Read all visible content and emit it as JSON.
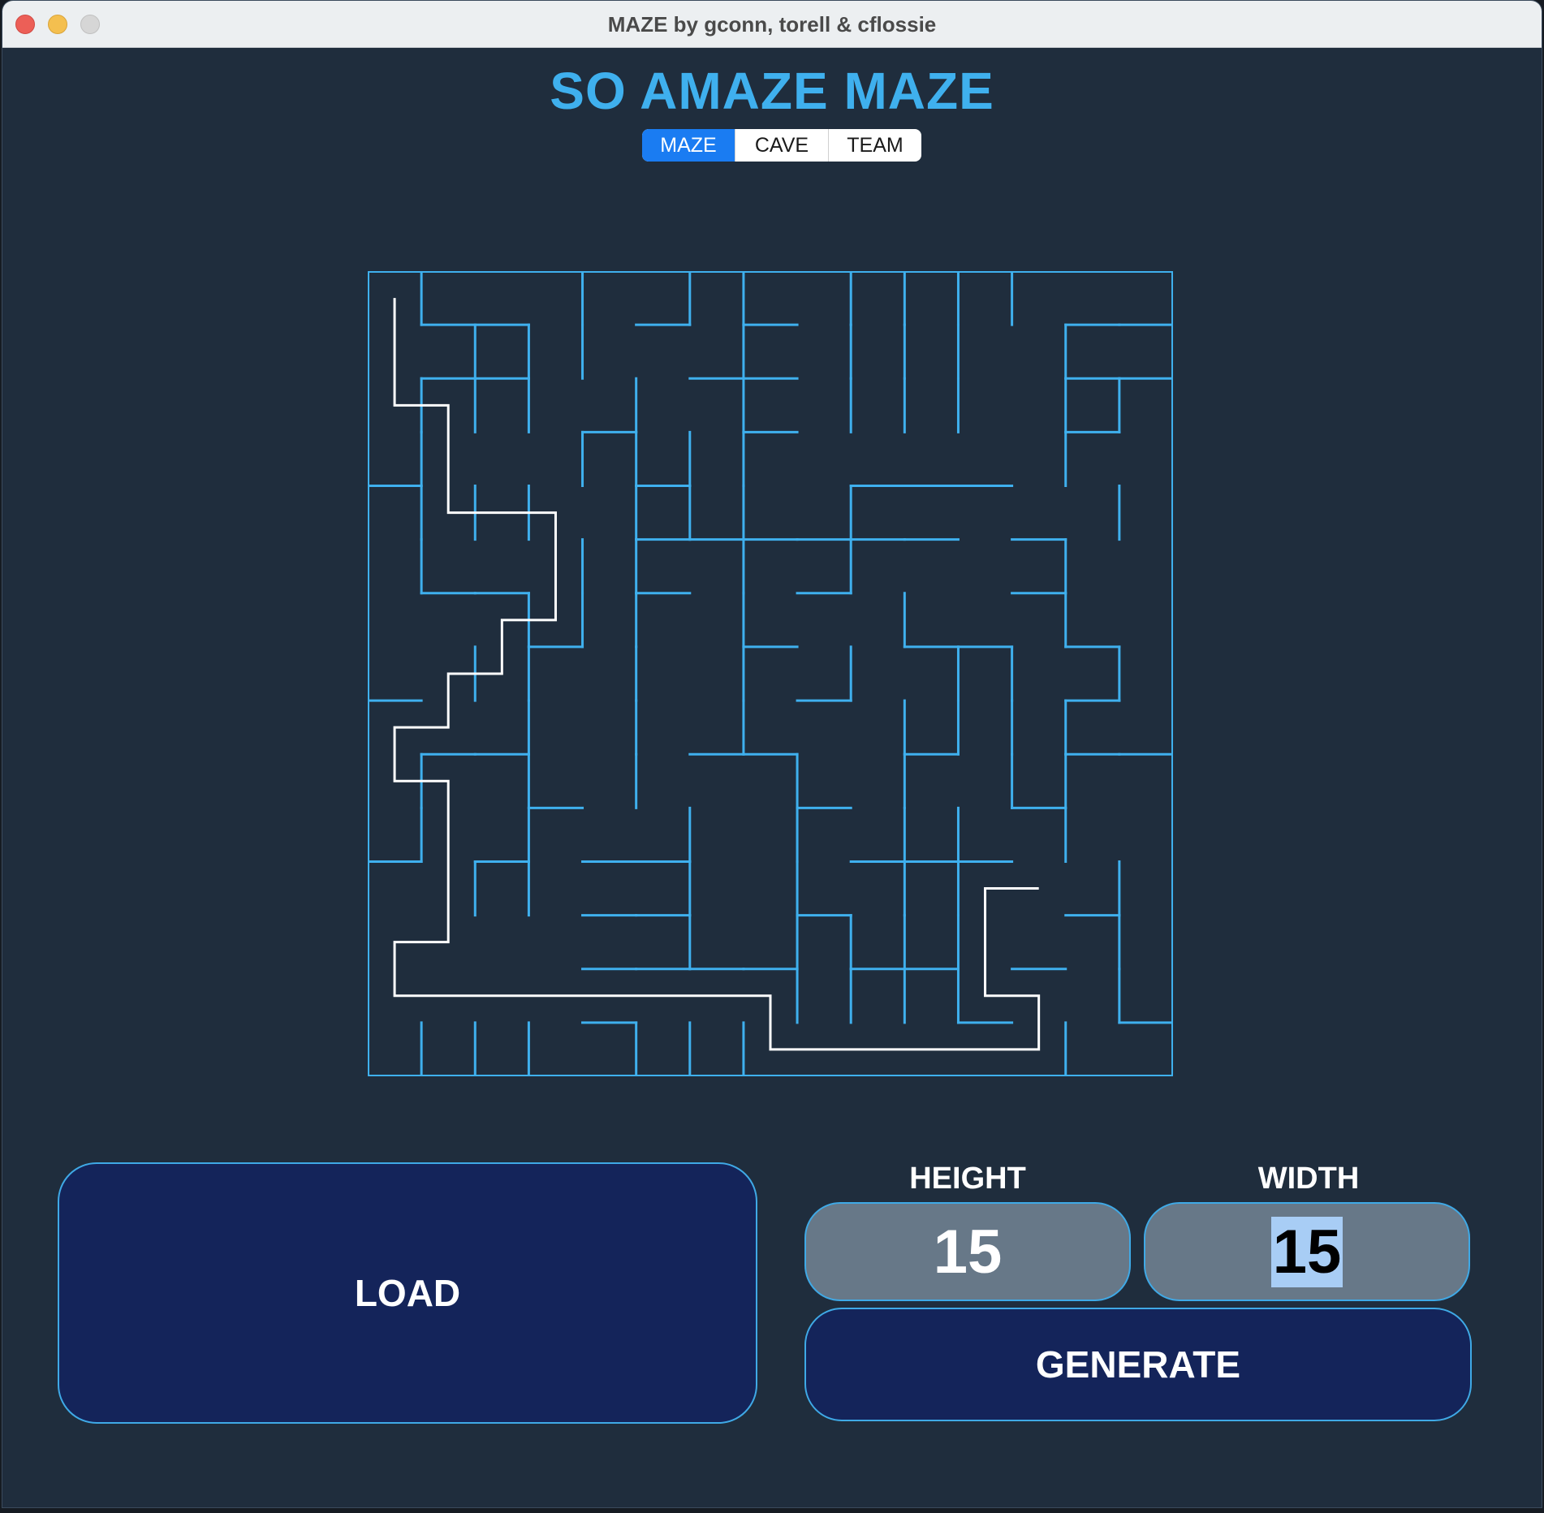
{
  "window": {
    "title": "MAZE by gconn, torell & cflossie"
  },
  "app": {
    "title": "SO AMAZE MAZE"
  },
  "tabs": [
    {
      "label": "MAZE",
      "active": true
    },
    {
      "label": "CAVE",
      "active": false
    },
    {
      "label": "TEAM",
      "active": false
    }
  ],
  "maze": {
    "rows": 15,
    "cols": 15,
    "wall_color": "#3fb0ee",
    "path_color": "#ffffff",
    "h_walls": [
      [
        1,
        1
      ],
      [
        1,
        2
      ],
      [
        1,
        5
      ],
      [
        1,
        7
      ],
      [
        1,
        13
      ],
      [
        1,
        14
      ],
      [
        2,
        1
      ],
      [
        2,
        2
      ],
      [
        2,
        6
      ],
      [
        2,
        7
      ],
      [
        2,
        13
      ],
      [
        2,
        14
      ],
      [
        3,
        4
      ],
      [
        3,
        7
      ],
      [
        3,
        13
      ],
      [
        4,
        0
      ],
      [
        4,
        5
      ],
      [
        4,
        9
      ],
      [
        4,
        10
      ],
      [
        4,
        11
      ],
      [
        5,
        5
      ],
      [
        5,
        6
      ],
      [
        5,
        7
      ],
      [
        5,
        8
      ],
      [
        5,
        9
      ],
      [
        5,
        10
      ],
      [
        5,
        12
      ],
      [
        6,
        1
      ],
      [
        6,
        2
      ],
      [
        6,
        5
      ],
      [
        6,
        8
      ],
      [
        6,
        12
      ],
      [
        7,
        3
      ],
      [
        7,
        7
      ],
      [
        7,
        10
      ],
      [
        7,
        11
      ],
      [
        7,
        13
      ],
      [
        8,
        0
      ],
      [
        8,
        8
      ],
      [
        8,
        13
      ],
      [
        9,
        1
      ],
      [
        9,
        2
      ],
      [
        9,
        6
      ],
      [
        9,
        7
      ],
      [
        9,
        10
      ],
      [
        9,
        13
      ],
      [
        9,
        14
      ],
      [
        10,
        3
      ],
      [
        10,
        8
      ],
      [
        10,
        12
      ],
      [
        11,
        0
      ],
      [
        11,
        2
      ],
      [
        11,
        4
      ],
      [
        11,
        5
      ],
      [
        11,
        9
      ],
      [
        11,
        10
      ],
      [
        11,
        11
      ],
      [
        12,
        4
      ],
      [
        12,
        5
      ],
      [
        12,
        8
      ],
      [
        12,
        13
      ],
      [
        13,
        4
      ],
      [
        13,
        5
      ],
      [
        13,
        6
      ],
      [
        13,
        7
      ],
      [
        13,
        9
      ],
      [
        13,
        10
      ],
      [
        13,
        12
      ],
      [
        14,
        4
      ],
      [
        14,
        11
      ],
      [
        14,
        14
      ]
    ],
    "v_walls": [
      [
        0,
        1
      ],
      [
        0,
        4
      ],
      [
        0,
        6
      ],
      [
        0,
        7
      ],
      [
        0,
        9
      ],
      [
        0,
        10
      ],
      [
        0,
        11
      ],
      [
        0,
        12
      ],
      [
        1,
        2
      ],
      [
        1,
        3
      ],
      [
        1,
        4
      ],
      [
        1,
        7
      ],
      [
        1,
        9
      ],
      [
        1,
        10
      ],
      [
        1,
        11
      ],
      [
        1,
        13
      ],
      [
        2,
        1
      ],
      [
        2,
        2
      ],
      [
        2,
        3
      ],
      [
        2,
        5
      ],
      [
        2,
        7
      ],
      [
        2,
        9
      ],
      [
        2,
        10
      ],
      [
        2,
        11
      ],
      [
        2,
        13
      ],
      [
        2,
        14
      ],
      [
        3,
        1
      ],
      [
        3,
        4
      ],
      [
        3,
        5
      ],
      [
        3,
        6
      ],
      [
        3,
        7
      ],
      [
        3,
        13
      ],
      [
        4,
        1
      ],
      [
        4,
        2
      ],
      [
        4,
        3
      ],
      [
        4,
        5
      ],
      [
        4,
        6
      ],
      [
        4,
        7
      ],
      [
        4,
        9
      ],
      [
        4,
        14
      ],
      [
        5,
        1
      ],
      [
        5,
        4
      ],
      [
        5,
        5
      ],
      [
        5,
        7
      ],
      [
        5,
        9
      ],
      [
        5,
        13
      ],
      [
        6,
        3
      ],
      [
        6,
        4
      ],
      [
        6,
        5
      ],
      [
        6,
        7
      ],
      [
        6,
        10
      ],
      [
        6,
        13
      ],
      [
        7,
        2
      ],
      [
        7,
        3
      ],
      [
        7,
        5
      ],
      [
        7,
        7
      ],
      [
        7,
        9
      ],
      [
        7,
        11
      ],
      [
        7,
        12
      ],
      [
        7,
        14
      ],
      [
        8,
        3
      ],
      [
        8,
        5
      ],
      [
        8,
        7
      ],
      [
        8,
        10
      ],
      [
        8,
        11
      ],
      [
        8,
        12
      ],
      [
        8,
        13
      ],
      [
        9,
        1
      ],
      [
        9,
        3
      ],
      [
        9,
        5
      ],
      [
        9,
        8
      ],
      [
        9,
        10
      ],
      [
        9,
        12
      ],
      [
        9,
        13
      ],
      [
        10,
        1
      ],
      [
        10,
        3
      ],
      [
        10,
        6
      ],
      [
        10,
        8
      ],
      [
        10,
        10
      ],
      [
        10,
        11
      ],
      [
        10,
        13
      ],
      [
        11,
        2
      ],
      [
        11,
        3
      ],
      [
        11,
        6
      ],
      [
        11,
        8
      ],
      [
        11,
        10
      ],
      [
        11,
        11
      ],
      [
        11,
        14
      ],
      [
        12,
        6
      ],
      [
        12,
        8
      ],
      [
        12,
        9
      ],
      [
        12,
        10
      ],
      [
        12,
        11
      ],
      [
        12,
        14
      ],
      [
        13,
        8
      ],
      [
        13,
        9
      ],
      [
        13,
        10
      ],
      [
        13,
        11
      ],
      [
        13,
        14
      ],
      [
        14,
        1
      ],
      [
        14,
        2
      ],
      [
        14,
        3
      ],
      [
        14,
        5
      ],
      [
        14,
        6
      ],
      [
        14,
        7
      ],
      [
        14,
        13
      ]
    ],
    "solution_path": [
      [
        0,
        0
      ],
      [
        1,
        0
      ],
      [
        2,
        0
      ],
      [
        2,
        1
      ],
      [
        3,
        1
      ],
      [
        4,
        1
      ],
      [
        4,
        2
      ],
      [
        4,
        3
      ],
      [
        5,
        3
      ],
      [
        6,
        3
      ],
      [
        6,
        2
      ],
      [
        7,
        2
      ],
      [
        7,
        1
      ],
      [
        8,
        1
      ],
      [
        8,
        0
      ],
      [
        9,
        0
      ],
      [
        9,
        1
      ],
      [
        10,
        1
      ],
      [
        11,
        1
      ],
      [
        12,
        1
      ],
      [
        12,
        0
      ],
      [
        13,
        0
      ],
      [
        13,
        1
      ],
      [
        13,
        2
      ],
      [
        13,
        3
      ],
      [
        13,
        4
      ],
      [
        13,
        5
      ],
      [
        13,
        6
      ],
      [
        13,
        7
      ],
      [
        14,
        7
      ],
      [
        14,
        8
      ],
      [
        14,
        9
      ],
      [
        14,
        10
      ],
      [
        14,
        11
      ],
      [
        14,
        12
      ],
      [
        13,
        12
      ],
      [
        13,
        11
      ],
      [
        12,
        11
      ],
      [
        11,
        11
      ],
      [
        11,
        12
      ]
    ]
  },
  "controls": {
    "load_label": "LOAD",
    "height_label": "HEIGHT",
    "width_label": "WIDTH",
    "height_value": "15",
    "width_value": "15",
    "generate_label": "GENERATE"
  }
}
